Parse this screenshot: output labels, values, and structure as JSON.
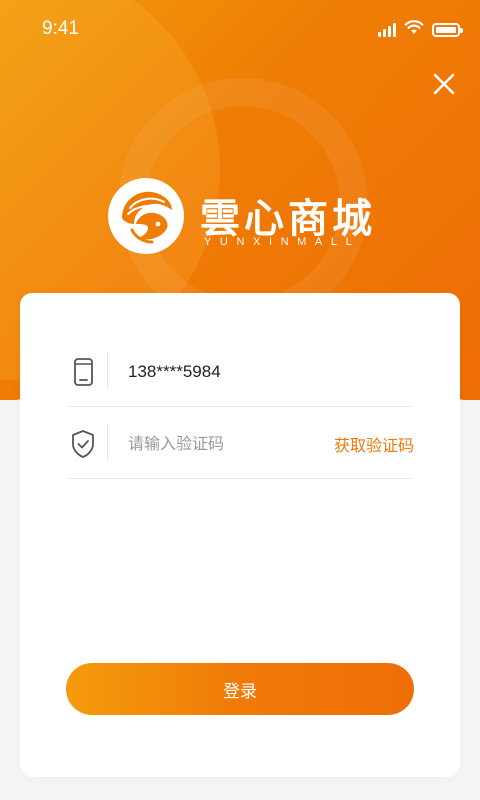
{
  "status_bar": {
    "time": "9:41"
  },
  "brand": {
    "name": "雲心商城",
    "subtitle": "YUNXINMALL"
  },
  "icons": {
    "close": "close-icon",
    "phone": "phone-icon",
    "shield": "shield-check-icon",
    "logo": "brand-logo-icon"
  },
  "form": {
    "phone_value": "138****5984",
    "code_placeholder": "请输入验证码",
    "get_code_label": "获取验证码",
    "login_label": "登录"
  },
  "colors": {
    "accent": "#ef7d05",
    "accent_light": "#f49b0c",
    "link": "#ee7a0a"
  }
}
